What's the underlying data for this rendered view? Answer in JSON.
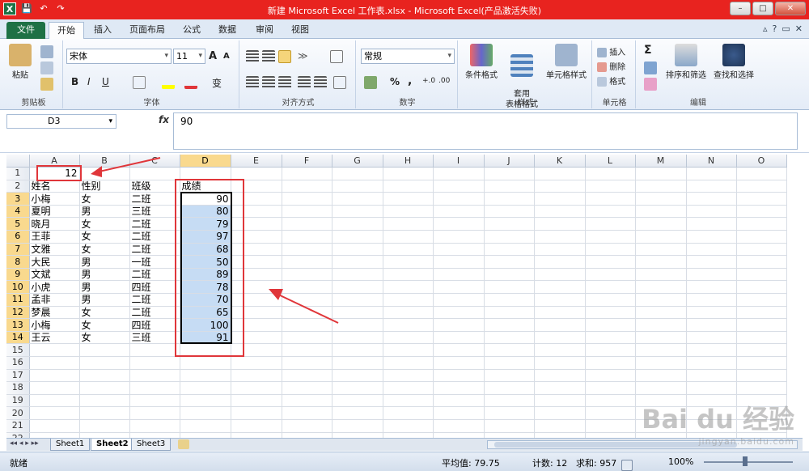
{
  "window": {
    "title": "新建 Microsoft Excel 工作表.xlsx  -  Microsoft Excel(产品激活失败)",
    "controls": [
      "–",
      "□",
      "✕"
    ]
  },
  "qat": {
    "logo": "X",
    "save": "💾",
    "undo": "↶",
    "redo": "↷"
  },
  "tabs": [
    {
      "label": "文件"
    },
    {
      "label": "开始"
    },
    {
      "label": "插入"
    },
    {
      "label": "页面布局"
    },
    {
      "label": "公式"
    },
    {
      "label": "数据"
    },
    {
      "label": "审阅"
    },
    {
      "label": "视图"
    }
  ],
  "ribbon": {
    "clipboard": {
      "label": "剪贴板",
      "paste": "粘贴"
    },
    "font": {
      "label": "字体",
      "name": "宋体",
      "size": "11",
      "bold": "B",
      "italic": "I",
      "underline": "U",
      "grow": "A",
      "shrink": "A",
      "phonetic": "变"
    },
    "alignment": {
      "label": "对齐方式"
    },
    "number": {
      "label": "数字",
      "format": "常规",
      "percent": "%",
      "comma": ","
    },
    "styles": {
      "label": "样式",
      "conditional": "条件格式",
      "table": "套用\n表格格式",
      "cell": "单元格样式"
    },
    "cells": {
      "label": "单元格",
      "insert": "插入",
      "delete": "删除",
      "format": "格式"
    },
    "editing": {
      "label": "编辑",
      "sum": "Σ",
      "sort": "排序和筛选",
      "find": "查找和选择"
    }
  },
  "formula_bar": {
    "name_box": "D3",
    "fx": "fx",
    "content": "90"
  },
  "columns": [
    "A",
    "B",
    "C",
    "D",
    "E",
    "F",
    "G",
    "H",
    "I",
    "J",
    "K",
    "L",
    "M",
    "N",
    "O"
  ],
  "rows": [
    [
      "",
      "12",
      "",
      "",
      ""
    ],
    [
      "",
      "姓名",
      "性别",
      "班级",
      "成绩"
    ],
    [
      "",
      "小梅",
      "女",
      "二班",
      "90"
    ],
    [
      "",
      "夏明",
      "男",
      "三班",
      "80"
    ],
    [
      "",
      "晓月",
      "女",
      "二班",
      "79"
    ],
    [
      "",
      "王菲",
      "女",
      "二班",
      "97"
    ],
    [
      "",
      "文雅",
      "女",
      "二班",
      "68"
    ],
    [
      "",
      "大民",
      "男",
      "一班",
      "50"
    ],
    [
      "",
      "文斌",
      "男",
      "二班",
      "89"
    ],
    [
      "",
      "小虎",
      "男",
      "四班",
      "78"
    ],
    [
      "",
      "孟非",
      "男",
      "二班",
      "70"
    ],
    [
      "",
      "梦晨",
      "女",
      "二班",
      "65"
    ],
    [
      "",
      "小梅",
      "女",
      "四班",
      "100"
    ],
    [
      "",
      "王云",
      "女",
      "三班",
      "91"
    ]
  ],
  "row_numbers": [
    "1",
    "2",
    "3",
    "4",
    "5",
    "6",
    "7",
    "8",
    "9",
    "10",
    "11",
    "12",
    "13",
    "14",
    "15",
    "16",
    "17",
    "18",
    "19",
    "20",
    "21",
    "22"
  ],
  "sheet_tabs": [
    "Sheet1",
    "Sheet2",
    "Sheet3"
  ],
  "active_sheet": "Sheet2",
  "status": {
    "mode": "就绪",
    "average": "平均值: 79.75",
    "count": "计数: 12",
    "sum": "求和: 957",
    "zoom": "100%"
  },
  "watermark": {
    "main": "Bai du 经验",
    "sub": "jingyan.baidu.com"
  },
  "colors": {
    "title_bar": "#e8231f",
    "file_tab": "#1e7145",
    "selection": "#c6dcf4",
    "annotation": "#e0363a"
  }
}
